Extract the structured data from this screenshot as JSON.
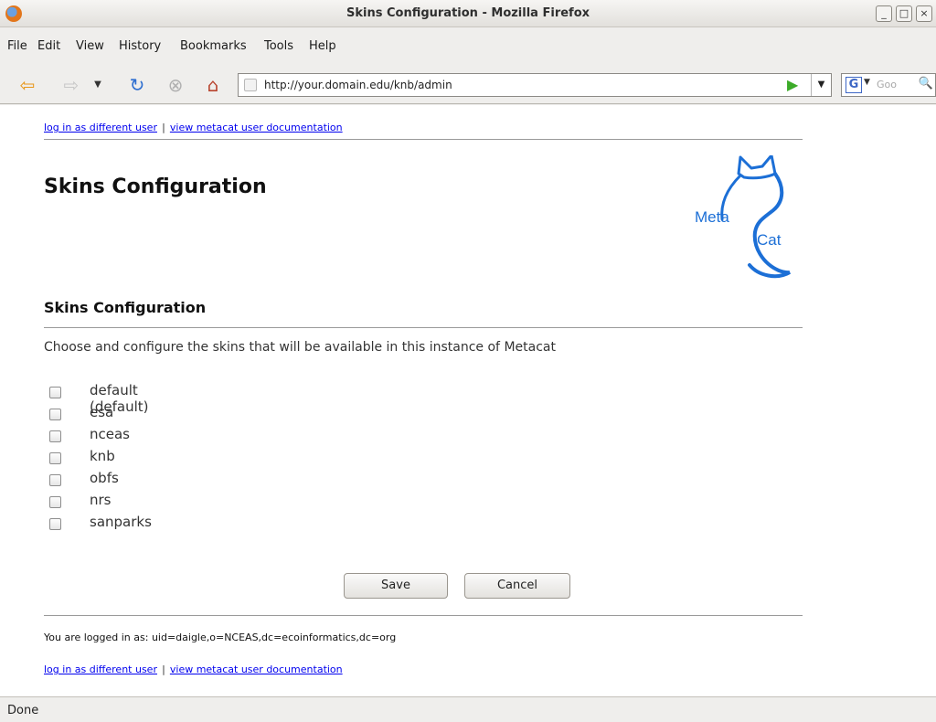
{
  "window": {
    "title": "Skins Configuration - Mozilla Firefox"
  },
  "menu": [
    "File",
    "Edit",
    "View",
    "History",
    "Bookmarks",
    "Tools",
    "Help"
  ],
  "toolbar": {
    "url": "http://your.domain.edu/knb/admin",
    "search_placeholder": "Goo",
    "search_engine_letter": "G"
  },
  "page": {
    "links": {
      "log_in": "log in as different user",
      "separator": "|",
      "docs": "view metacat user documentation"
    },
    "title": "Skins Configuration",
    "logo": {
      "meta": "Meta",
      "cat": "Cat"
    },
    "section_title": "Skins Configuration",
    "intro": "Choose and configure the skins that will be available in this instance of Metacat",
    "skins": [
      "default (default)",
      "esa",
      "nceas",
      "knb",
      "obfs",
      "nrs",
      "sanparks"
    ],
    "buttons": {
      "save": "Save",
      "cancel": "Cancel"
    },
    "logged_in": "You are logged in as: uid=daigle,o=NCEAS,dc=ecoinformatics,dc=org"
  },
  "status": "Done",
  "colors": {
    "link": "#0000ee",
    "logo_blue": "#1c6fd6"
  }
}
